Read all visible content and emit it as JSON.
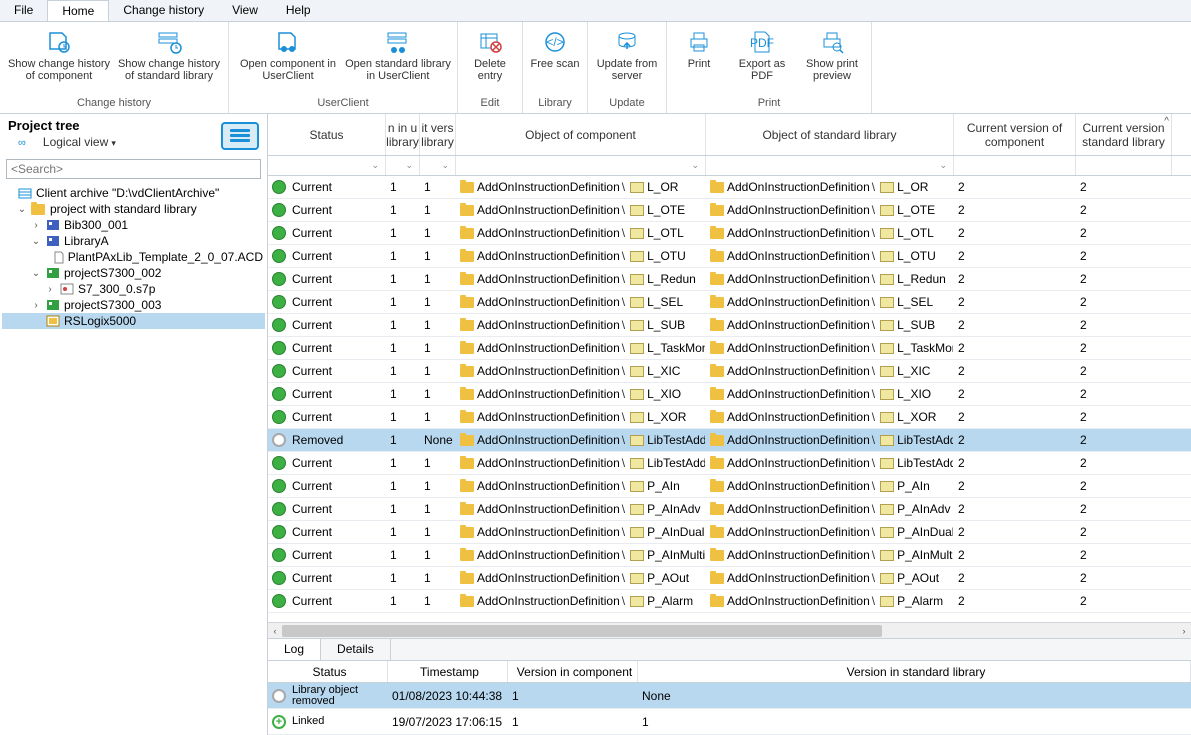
{
  "menu": {
    "items": [
      "File",
      "Home",
      "Change history",
      "View",
      "Help"
    ],
    "active": 1
  },
  "ribbon": {
    "groups": [
      {
        "label": "Change history",
        "buttons": [
          {
            "name": "change-history-component",
            "label": "Show change history of component"
          },
          {
            "name": "change-history-stdlib",
            "label": "Show change history of standard library"
          }
        ]
      },
      {
        "label": "UserClient",
        "buttons": [
          {
            "name": "open-component",
            "label": "Open component in UserClient"
          },
          {
            "name": "open-stdlib",
            "label": "Open standard library in UserClient"
          }
        ]
      },
      {
        "label": "Edit",
        "buttons": [
          {
            "name": "delete-entry",
            "label": "Delete entry"
          }
        ]
      },
      {
        "label": "Library",
        "buttons": [
          {
            "name": "free-scan",
            "label": "Free scan"
          }
        ]
      },
      {
        "label": "Update",
        "buttons": [
          {
            "name": "update-from-server",
            "label": "Update from server"
          }
        ]
      },
      {
        "label": "Print",
        "buttons": [
          {
            "name": "print",
            "label": "Print"
          },
          {
            "name": "export-pdf",
            "label": "Export as PDF"
          },
          {
            "name": "print-preview",
            "label": "Show print preview"
          }
        ]
      }
    ]
  },
  "sidebar": {
    "title": "Project tree",
    "view_label": "Logical view",
    "search_placeholder": "<Search>",
    "nodes": [
      {
        "depth": 0,
        "toggle": "",
        "icon": "archive",
        "label": "Client archive \"D:\\vdClientArchive\""
      },
      {
        "depth": 1,
        "toggle": "v",
        "icon": "folder",
        "label": "project with standard library"
      },
      {
        "depth": 2,
        "toggle": ">",
        "icon": "proj-b",
        "label": "Bib300_001"
      },
      {
        "depth": 2,
        "toggle": "v",
        "icon": "proj-b",
        "label": "LibraryA"
      },
      {
        "depth": 3,
        "toggle": "",
        "icon": "file",
        "label": "PlantPAxLib_Template_2_0_07.ACD"
      },
      {
        "depth": 2,
        "toggle": "v",
        "icon": "proj-g",
        "label": "projectS7300_002"
      },
      {
        "depth": 3,
        "toggle": ">",
        "icon": "s7",
        "label": "S7_300_0.s7p"
      },
      {
        "depth": 2,
        "toggle": ">",
        "icon": "proj-g",
        "label": "projectS7300_003"
      },
      {
        "depth": 2,
        "toggle": "",
        "icon": "rslogix",
        "label": "RSLogix5000",
        "selected": true
      }
    ]
  },
  "grid": {
    "headers": {
      "status": "Status",
      "v1": "n in u library",
      "v2": "it vers library",
      "obj1": "Object of component",
      "obj2": "Object of standard library",
      "cv1": "Current version of component",
      "cv2": "Current version standard library"
    },
    "rows": [
      {
        "status": "Current",
        "dot": "green",
        "v1": "1",
        "v2": "1",
        "name": "L_OR",
        "cv1": "2",
        "cv2": "2"
      },
      {
        "status": "Current",
        "dot": "green",
        "v1": "1",
        "v2": "1",
        "name": "L_OTE",
        "cv1": "2",
        "cv2": "2"
      },
      {
        "status": "Current",
        "dot": "green",
        "v1": "1",
        "v2": "1",
        "name": "L_OTL",
        "cv1": "2",
        "cv2": "2"
      },
      {
        "status": "Current",
        "dot": "green",
        "v1": "1",
        "v2": "1",
        "name": "L_OTU",
        "cv1": "2",
        "cv2": "2"
      },
      {
        "status": "Current",
        "dot": "green",
        "v1": "1",
        "v2": "1",
        "name": "L_Redun",
        "cv1": "2",
        "cv2": "2"
      },
      {
        "status": "Current",
        "dot": "green",
        "v1": "1",
        "v2": "1",
        "name": "L_SEL",
        "cv1": "2",
        "cv2": "2"
      },
      {
        "status": "Current",
        "dot": "green",
        "v1": "1",
        "v2": "1",
        "name": "L_SUB",
        "cv1": "2",
        "cv2": "2"
      },
      {
        "status": "Current",
        "dot": "green",
        "v1": "1",
        "v2": "1",
        "name": "L_TaskMon",
        "cv1": "2",
        "cv2": "2"
      },
      {
        "status": "Current",
        "dot": "green",
        "v1": "1",
        "v2": "1",
        "name": "L_XIC",
        "cv1": "2",
        "cv2": "2"
      },
      {
        "status": "Current",
        "dot": "green",
        "v1": "1",
        "v2": "1",
        "name": "L_XIO",
        "cv1": "2",
        "cv2": "2"
      },
      {
        "status": "Current",
        "dot": "green",
        "v1": "1",
        "v2": "1",
        "name": "L_XOR",
        "cv1": "2",
        "cv2": "2"
      },
      {
        "status": "Removed",
        "dot": "grey",
        "v1": "1",
        "v2": "None",
        "name": "LibTestAdd",
        "cv1": "2",
        "cv2": "2",
        "selected": true
      },
      {
        "status": "Current",
        "dot": "green",
        "v1": "1",
        "v2": "1",
        "name": "LibTestAddSec",
        "cv1": "2",
        "cv2": "2"
      },
      {
        "status": "Current",
        "dot": "green",
        "v1": "1",
        "v2": "1",
        "name": "P_AIn",
        "cv1": "2",
        "cv2": "2"
      },
      {
        "status": "Current",
        "dot": "green",
        "v1": "1",
        "v2": "1",
        "name": "P_AInAdv",
        "cv1": "2",
        "cv2": "2"
      },
      {
        "status": "Current",
        "dot": "green",
        "v1": "1",
        "v2": "1",
        "name": "P_AInDual",
        "cv1": "2",
        "cv2": "2"
      },
      {
        "status": "Current",
        "dot": "green",
        "v1": "1",
        "v2": "1",
        "name": "P_AInMulti",
        "cv1": "2",
        "cv2": "2"
      },
      {
        "status": "Current",
        "dot": "green",
        "v1": "1",
        "v2": "1",
        "name": "P_AOut",
        "cv1": "2",
        "cv2": "2"
      },
      {
        "status": "Current",
        "dot": "green",
        "v1": "1",
        "v2": "1",
        "name": "P_Alarm",
        "cv1": "2",
        "cv2": "2"
      }
    ],
    "path_prefix": "AddOnInstructionDefinition"
  },
  "bottom": {
    "tabs": [
      "Log",
      "Details"
    ],
    "active_tab": 0,
    "headers": {
      "status": "Status",
      "ts": "Timestamp",
      "vc": "Version in component",
      "vs": "Version in standard library"
    },
    "rows": [
      {
        "dot": "grey",
        "status": "Library object removed",
        "ts": "01/08/2023 10:44:38",
        "vc": "1",
        "vs": "None",
        "selected": true
      },
      {
        "dot": "plus",
        "status": "Linked",
        "ts": "19/07/2023 17:06:15",
        "vc": "1",
        "vs": "1"
      }
    ]
  }
}
